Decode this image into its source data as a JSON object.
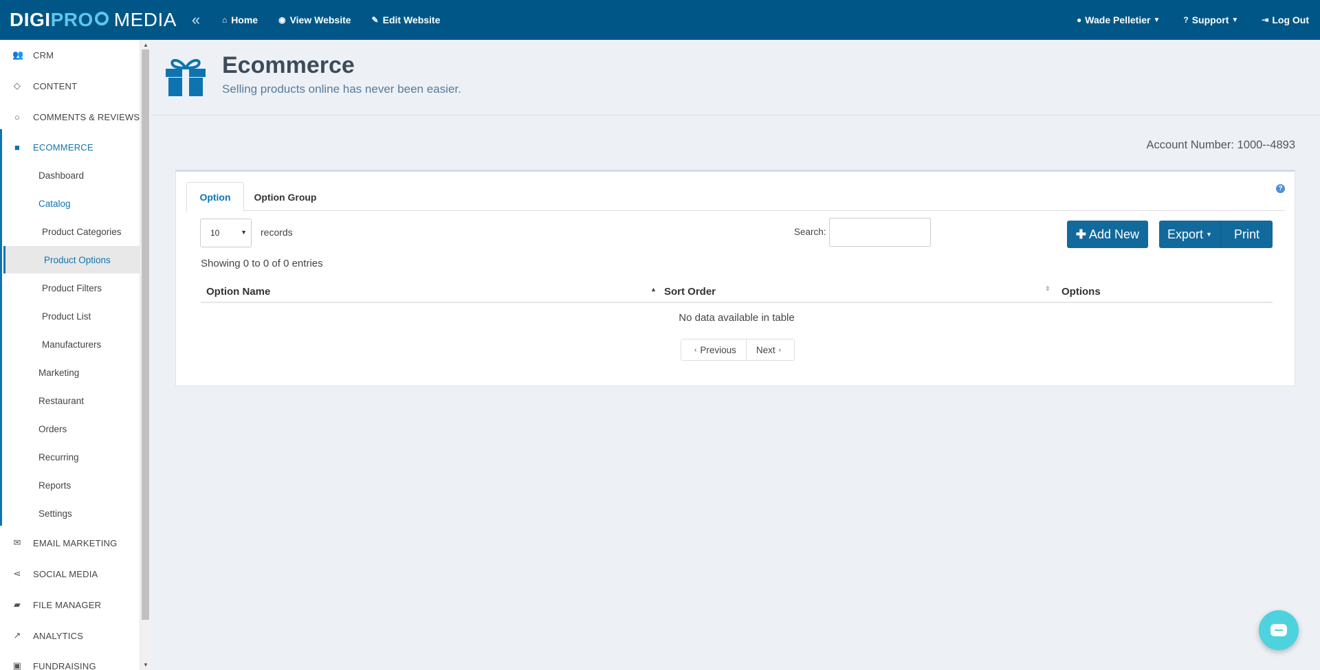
{
  "topbar": {
    "logo": {
      "digi": "DIGI",
      "pro": "PRO",
      "media": "MEDIA"
    },
    "collapse_icon": "double-chevron-left-icon",
    "nav": [
      {
        "label": "Home",
        "icon": "home-icon"
      },
      {
        "label": "View Website",
        "icon": "eye-icon"
      },
      {
        "label": "Edit Website",
        "icon": "edit-icon"
      }
    ],
    "user": "Wade Pelletier",
    "support": "Support",
    "logout": "Log Out"
  },
  "sidebar": {
    "sections": [
      {
        "label": "CRM",
        "icon": "users-icon"
      },
      {
        "label": "CONTENT",
        "icon": "diamond-icon"
      },
      {
        "label": "COMMENTS & REVIEWS",
        "icon": "comment-icon"
      },
      {
        "label": "ECOMMERCE",
        "icon": "gift-icon",
        "active": true
      },
      {
        "label": "EMAIL MARKETING",
        "icon": "envelope-icon"
      },
      {
        "label": "SOCIAL MEDIA",
        "icon": "share-icon"
      },
      {
        "label": "FILE MANAGER",
        "icon": "folder-open-icon"
      },
      {
        "label": "ANALYTICS",
        "icon": "line-chart-icon"
      },
      {
        "label": "FUNDRAISING",
        "icon": "money-icon"
      }
    ],
    "ecommerce_items": [
      "Dashboard",
      "Catalog",
      "Product Categories",
      "Product Options",
      "Product Filters",
      "Product List",
      "Manufacturers",
      "Marketing",
      "Restaurant",
      "Orders",
      "Recurring",
      "Reports",
      "Settings"
    ]
  },
  "header": {
    "title": "Ecommerce",
    "subtitle": "Selling products online has never been easier."
  },
  "account": "Account Number: 1000--4893",
  "tabs": [
    "Option",
    "Option Group"
  ],
  "controls": {
    "page_length": "10",
    "records_label": "records",
    "search_label": "Search:",
    "search_value": "",
    "add_new": "Add New",
    "export": "Export",
    "print": "Print"
  },
  "table": {
    "info": "Showing 0 to 0 of 0 entries",
    "columns": [
      "Option Name",
      "Sort Order",
      "Options"
    ],
    "empty": "No data available in table"
  },
  "pagination": {
    "previous": "Previous",
    "next": "Next"
  },
  "colors": {
    "topbar": "#005787",
    "accent": "#0e74b0",
    "button": "#12699c",
    "chat": "#4dd3de"
  }
}
